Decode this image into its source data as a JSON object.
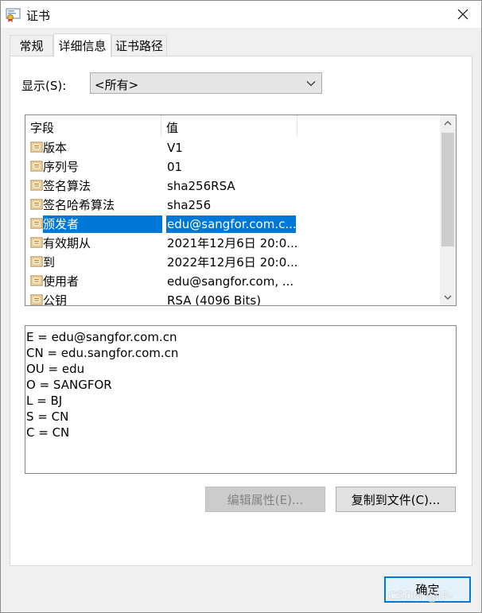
{
  "window": {
    "title": "证书",
    "close_icon": "close-icon"
  },
  "tabs": [
    {
      "label": "常规",
      "active": false
    },
    {
      "label": "详细信息",
      "active": true
    },
    {
      "label": "证书路径",
      "active": false
    }
  ],
  "show": {
    "label": "显示(S):",
    "selected": "<所有>"
  },
  "list": {
    "columns": [
      "字段",
      "值"
    ],
    "rows": [
      {
        "field": "版本",
        "value": "V1",
        "selected": false
      },
      {
        "field": "序列号",
        "value": "01",
        "selected": false
      },
      {
        "field": "签名算法",
        "value": "sha256RSA",
        "selected": false
      },
      {
        "field": "签名哈希算法",
        "value": "sha256",
        "selected": false
      },
      {
        "field": "颁发者",
        "value": "edu@sangfor.com.c...",
        "selected": true
      },
      {
        "field": "有效期从",
        "value": "2021年12月6日 20:0...",
        "selected": false
      },
      {
        "field": "到",
        "value": "2022年12月6日 20:0...",
        "selected": false
      },
      {
        "field": "使用者",
        "value": "edu@sangfor.com, ...",
        "selected": false
      },
      {
        "field": "公钥",
        "value": "RSA (4096 Bits)",
        "selected": false
      }
    ]
  },
  "detail": {
    "lines": [
      "E = edu@sangfor.com.cn",
      "CN = edu.sangfor.com.cn",
      "OU = edu",
      "O = SANGFOR",
      "L = BJ",
      "S = CN",
      "C = CN"
    ]
  },
  "buttons": {
    "edit_properties": "编辑属性(E)...",
    "copy_to_file": "复制到文件(C)...",
    "ok": "确定"
  },
  "watermark": "CSDN @IP-",
  "colors": {
    "selection": "#0078d7",
    "ok_border": "#0078d7"
  }
}
